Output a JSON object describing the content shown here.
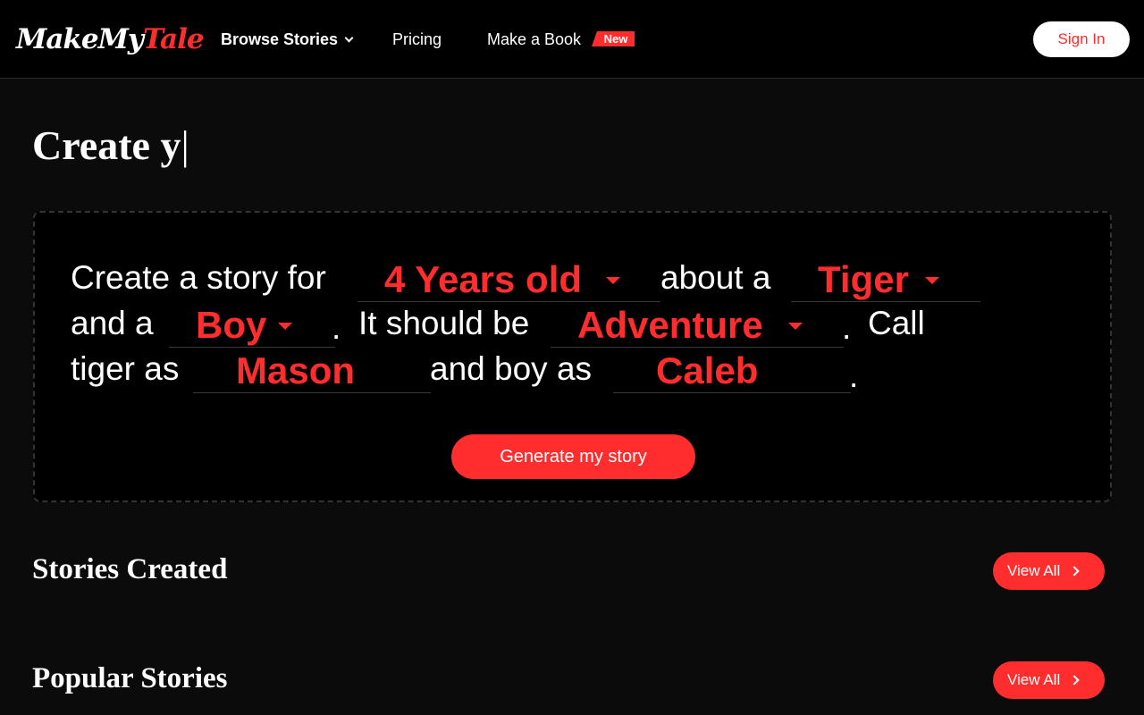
{
  "header": {
    "logo_part_a": "MakeMy",
    "logo_part_b": "Tale",
    "nav": {
      "browse_label": "Browse Stories",
      "pricing_label": "Pricing",
      "make_book_label": "Make a Book",
      "new_badge": "New"
    },
    "signin_label": "Sign In"
  },
  "headline": {
    "typed_text": "Create y",
    "cursor": "|"
  },
  "builder": {
    "text_1": "Create a story for",
    "age": "4 Years old",
    "text_2": "about a",
    "animal": "Tiger",
    "text_3": "and a",
    "gender": "Boy",
    "text_4": "It should be",
    "genre": "Adventure",
    "text_5": "Call",
    "text_6": "tiger as",
    "animal_name": "Mason",
    "text_7": "and boy as",
    "child_name": "Caleb",
    "period": ".",
    "generate_label": "Generate my story"
  },
  "sections": {
    "stories_created": {
      "title": "Stories Created",
      "view_all": "View All"
    },
    "popular_stories": {
      "title": "Popular Stories",
      "view_all": "View All"
    }
  },
  "colors": {
    "accent": "#ff2d2d",
    "background": "#0b0b0b",
    "header_bg": "#000000"
  },
  "icons": [
    "chevron-down-icon",
    "caret-down-icon",
    "chevron-right-icon"
  ]
}
